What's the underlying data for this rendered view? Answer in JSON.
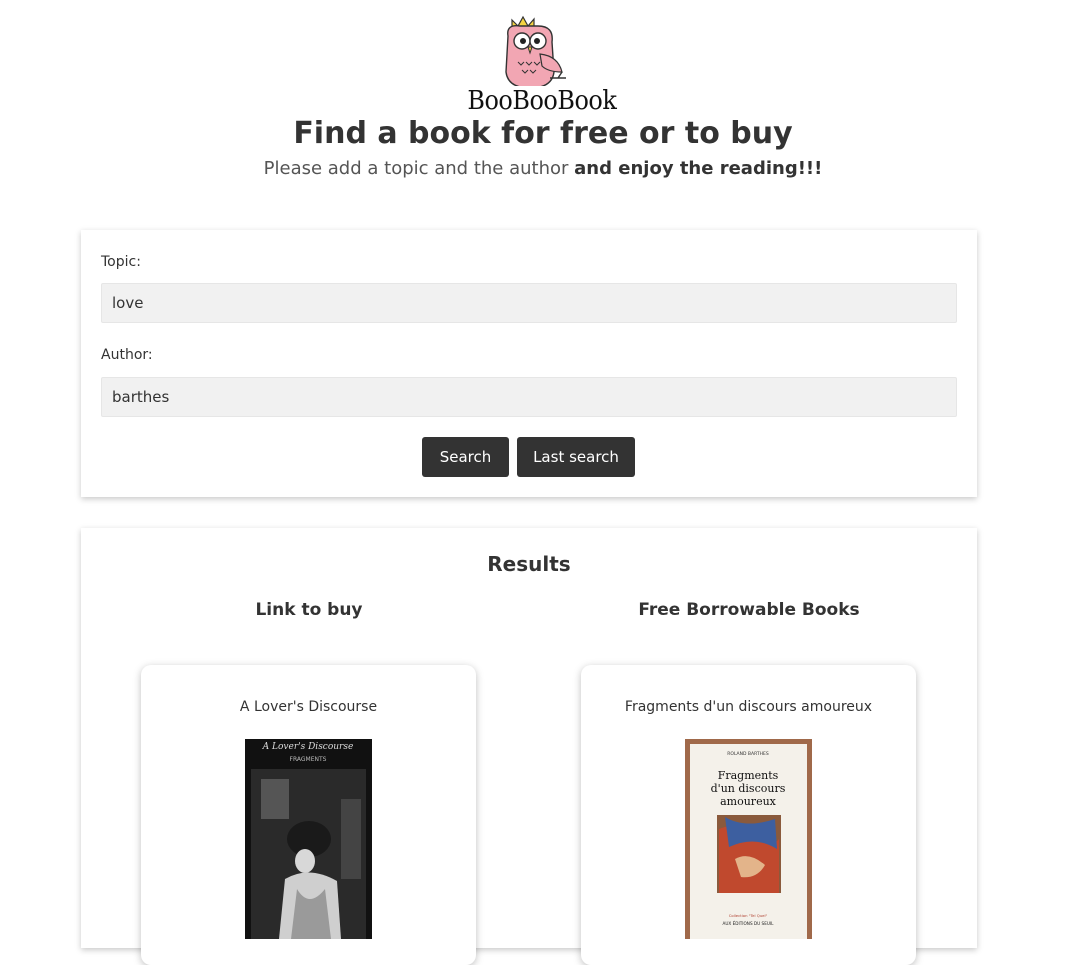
{
  "logo": {
    "name": "BooBooBook",
    "icon": "owl-icon"
  },
  "header": {
    "title": "Find a book for free or to buy",
    "subtitle_plain": "Please add a topic and the author",
    "subtitle_bold": "and enjoy the reading!!!"
  },
  "form": {
    "topic_label": "Topic:",
    "topic_value": "love",
    "author_label": "Author:",
    "author_value": "barthes",
    "search_label": "Search",
    "last_search_label": "Last search"
  },
  "results": {
    "title": "Results",
    "buy_heading": "Link to buy",
    "free_heading": "Free Borrowable Books",
    "buy_book": {
      "title": "A Lover's Discourse",
      "cover_text": [
        "A Lover's Discourse",
        "FRAGMENTS"
      ]
    },
    "free_book": {
      "title": "Fragments d'un discours amoureux",
      "cover_text": [
        "ROLAND BARTHES",
        "Fragments",
        "d'un discours",
        "amoureux",
        "Collection \"Tel Quel\"",
        "AUX ÉDITIONS DU SEUIL"
      ]
    }
  },
  "colors": {
    "button": "#333333",
    "input_bg": "#f1f1f1",
    "owl": "#f2a6b3",
    "crown": "#f5d442"
  }
}
